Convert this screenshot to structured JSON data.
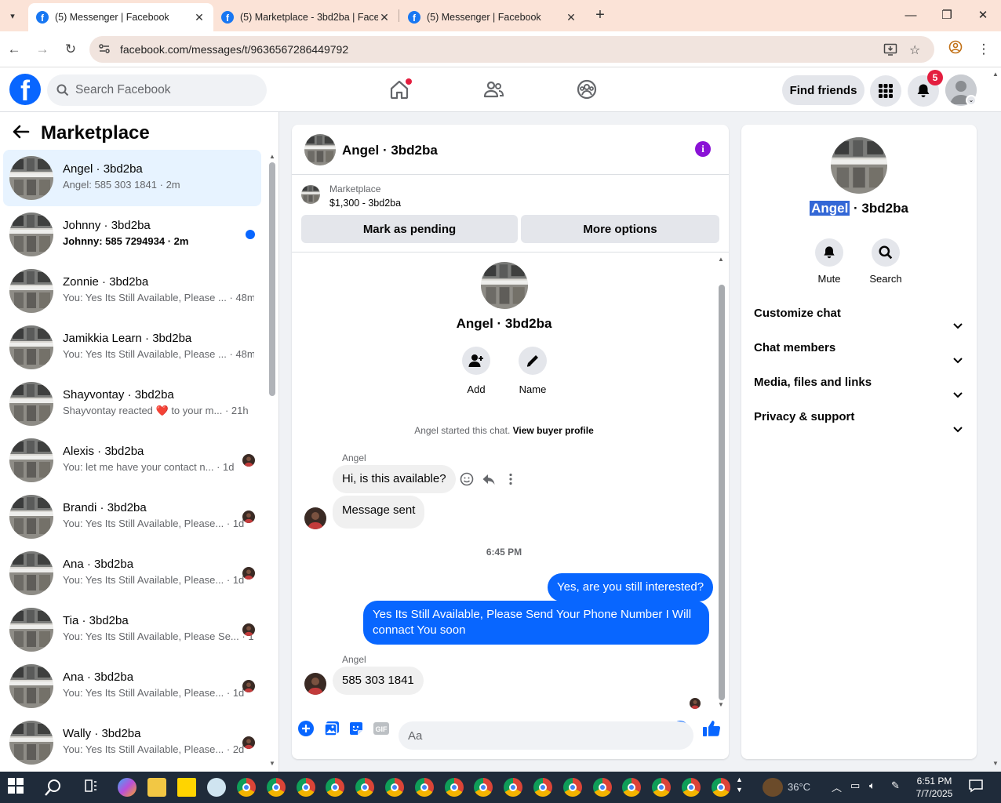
{
  "browser": {
    "tabs": [
      {
        "title": "(5) Messenger | Facebook",
        "active": true
      },
      {
        "title": "(5) Marketplace - 3bd2ba | Face",
        "active": false
      },
      {
        "title": "(5) Messenger | Facebook",
        "active": false
      }
    ],
    "url": "facebook.com/messages/t/9636567286449792"
  },
  "fb_header": {
    "search_placeholder": "Search Facebook",
    "find_friends": "Find friends",
    "notifications_count": "5"
  },
  "left_panel": {
    "title": "Marketplace",
    "conversations": [
      {
        "name": "Angel · 3bd2ba",
        "preview": "Angel: 585 303 1841",
        "time": "2m",
        "selected": true,
        "unread": false
      },
      {
        "name": "Johnny · 3bd2ba",
        "preview": "Johnny: 585 7294934",
        "time": "2m",
        "selected": false,
        "unread": true
      },
      {
        "name": "Zonnie · 3bd2ba",
        "preview": "You: Yes Its Still Available, Please ...",
        "time": "48m",
        "selected": false,
        "unread": false
      },
      {
        "name": "Jamikkia Learn · 3bd2ba",
        "preview": "You: Yes Its Still Available, Please ...",
        "time": "48m",
        "selected": false,
        "unread": false
      },
      {
        "name": "Shayvontay · 3bd2ba",
        "preview": "Shayvontay reacted ❤️ to your m...",
        "time": "21h",
        "selected": false,
        "unread": false
      },
      {
        "name": "Alexis · 3bd2ba",
        "preview": "You: let me have your contact n...",
        "time": "1d",
        "selected": false,
        "unread": false
      },
      {
        "name": "Brandi · 3bd2ba",
        "preview": "You: Yes Its Still Available, Please...",
        "time": "1d",
        "selected": false,
        "unread": false
      },
      {
        "name": "Ana · 3bd2ba",
        "preview": "You: Yes Its Still Available, Please...",
        "time": "1d",
        "selected": false,
        "unread": false
      },
      {
        "name": "Tia · 3bd2ba",
        "preview": "You: Yes Its Still Available, Please Se...",
        "time": "1d",
        "selected": false,
        "unread": false
      },
      {
        "name": "Ana · 3bd2ba",
        "preview": "You: Yes Its Still Available, Please...",
        "time": "1d",
        "selected": false,
        "unread": false
      },
      {
        "name": "Wally · 3bd2ba",
        "preview": "You: Yes Its Still Available, Please...",
        "time": "2d",
        "selected": false,
        "unread": false
      }
    ]
  },
  "chat": {
    "header_name": "Angel · 3bd2ba",
    "listing": {
      "category": "Marketplace",
      "price_title": "$1,300 - 3bd2ba",
      "mark_pending": "Mark as pending",
      "more_options": "More options"
    },
    "profile": {
      "name": "Angel · 3bd2ba",
      "add_label": "Add",
      "name_label": "Name"
    },
    "started_text": "Angel started this chat.",
    "view_profile": "View buyer profile",
    "messages": {
      "sender1": "Angel",
      "msg1": "Hi, is this available?",
      "msg2": "Message sent",
      "time": "6:45 PM",
      "out1": "Yes, are you still interested?",
      "out2": "Yes Its Still Available, Please Send Your Phone Number I Will connact You soon",
      "sender2": "Angel",
      "msg3": "585 303 1841"
    },
    "composer_placeholder": "Aa"
  },
  "right_panel": {
    "name_first": "Angel",
    "name_rest": " · 3bd2ba",
    "mute": "Mute",
    "search": "Search",
    "sections": [
      "Customize chat",
      "Chat members",
      "Media, files and links",
      "Privacy & support"
    ]
  },
  "taskbar": {
    "temperature": "36°C",
    "time": "6:51 PM",
    "date": "7/7/2025"
  },
  "colors": {
    "fb_blue": "#0866ff",
    "selected_row": "#e7f3ff",
    "badge_red": "#e41e3f",
    "info_purple": "#8a12d6"
  }
}
